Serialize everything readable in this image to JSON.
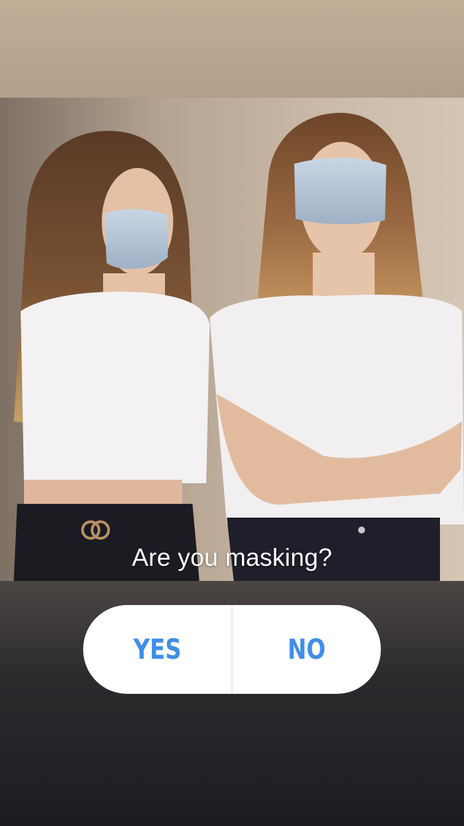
{
  "story": {
    "photo_icon": "photo-two-women-with-masks",
    "question": "Are you masking?",
    "poll": {
      "options": [
        {
          "label": "YES"
        },
        {
          "label": "NO"
        }
      ],
      "option_color": "#3f8ee8"
    }
  }
}
